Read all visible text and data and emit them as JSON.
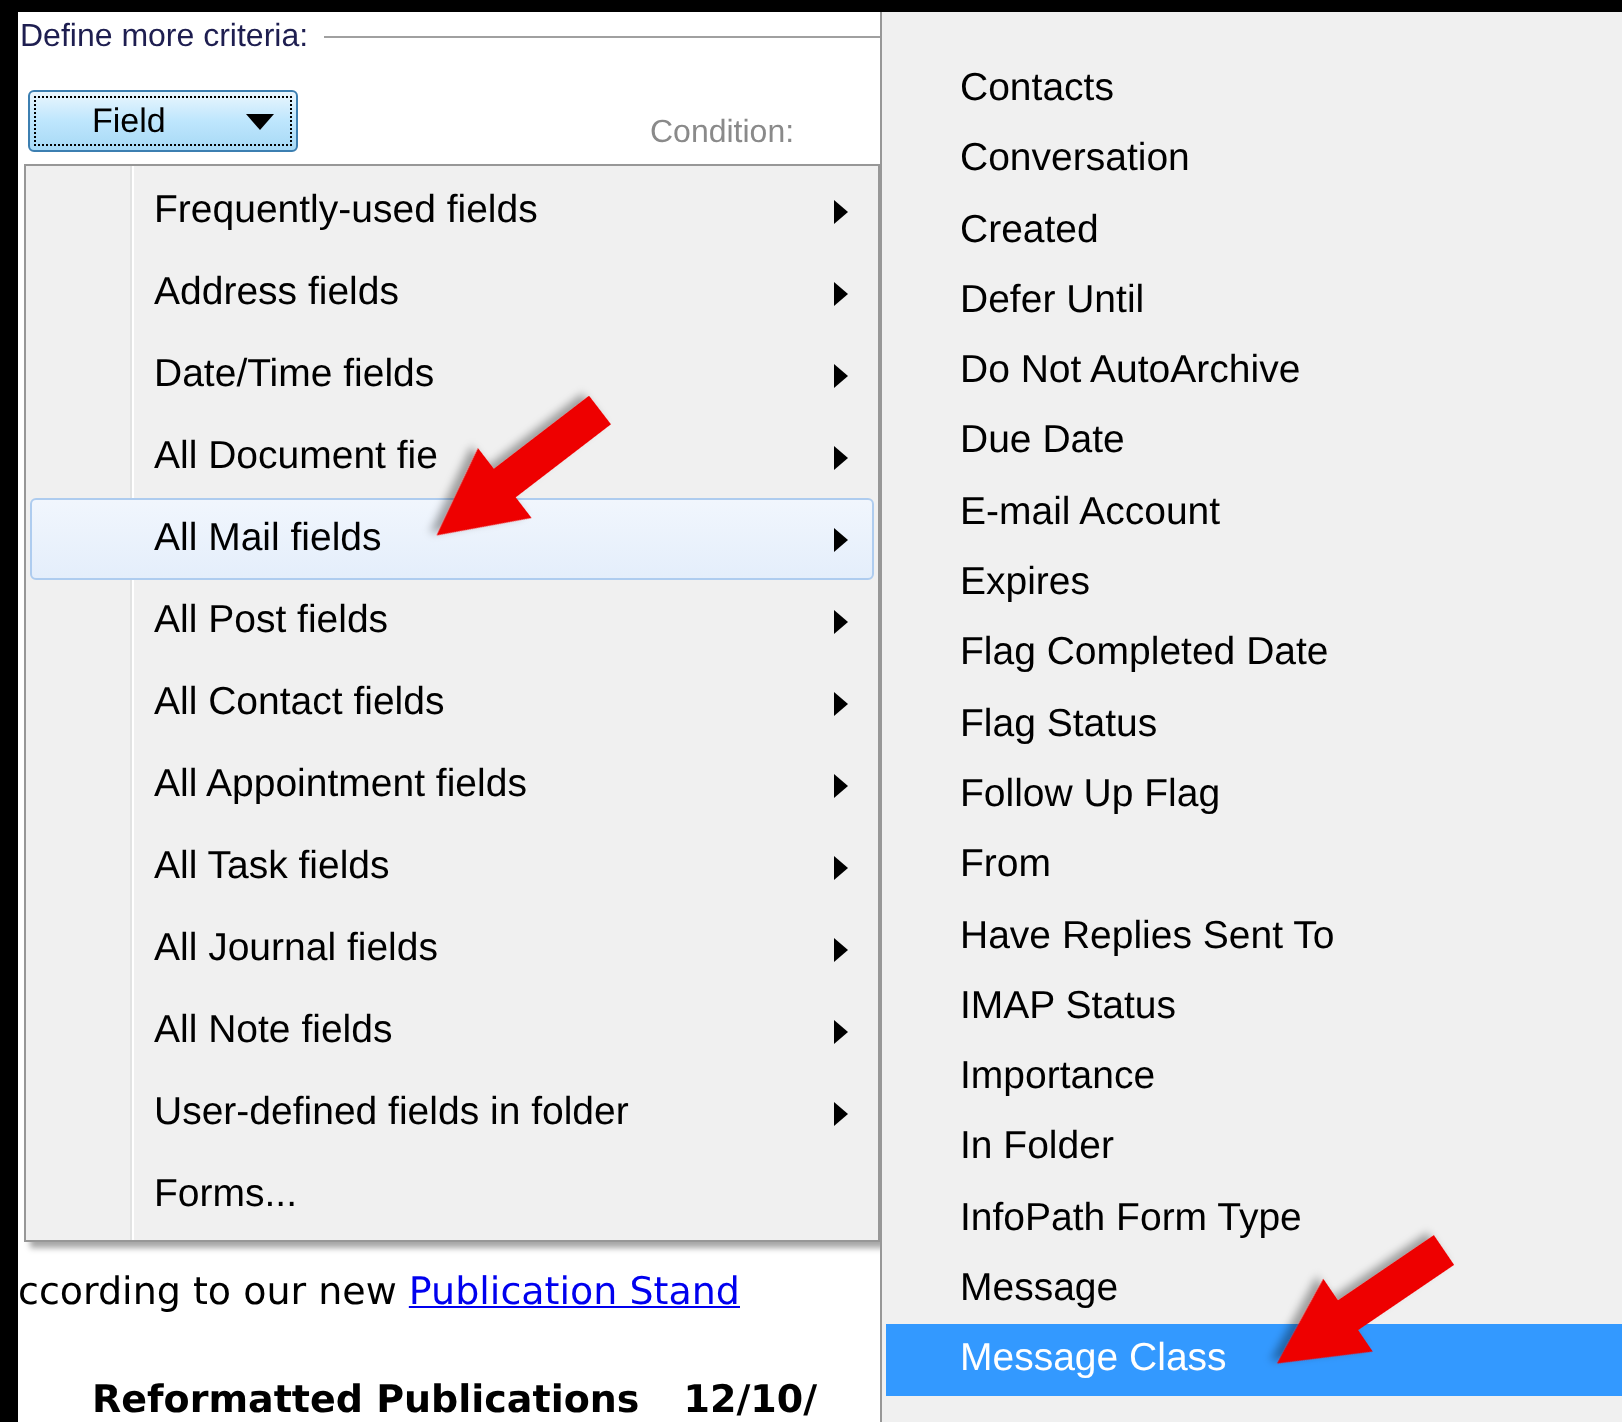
{
  "criteria_label": "Define more criteria:",
  "field_button": {
    "label": "Field"
  },
  "condition_label": "Condition:",
  "field_menu": {
    "items": [
      {
        "label": "Frequently-used fields",
        "submenu": true,
        "selected": false
      },
      {
        "label": "Address fields",
        "submenu": true,
        "selected": false
      },
      {
        "label": "Date/Time fields",
        "submenu": true,
        "selected": false
      },
      {
        "label": "All Document fie",
        "submenu": true,
        "selected": false
      },
      {
        "label": "All Mail fields",
        "submenu": true,
        "selected": true
      },
      {
        "label": "All Post fields",
        "submenu": true,
        "selected": false
      },
      {
        "label": "All Contact fields",
        "submenu": true,
        "selected": false
      },
      {
        "label": "All Appointment fields",
        "submenu": true,
        "selected": false
      },
      {
        "label": "All Task fields",
        "submenu": true,
        "selected": false
      },
      {
        "label": "All Journal fields",
        "submenu": true,
        "selected": false
      },
      {
        "label": "All Note fields",
        "submenu": true,
        "selected": false
      },
      {
        "label": "User-defined fields in folder",
        "submenu": true,
        "selected": false
      },
      {
        "label": "Forms...",
        "submenu": false,
        "selected": false
      }
    ]
  },
  "body_text": {
    "text": "ccording to our new ",
    "link": "Publication Stand"
  },
  "heading": {
    "title": "Reformatted Publications",
    "date": "12/10/"
  },
  "submenu": {
    "items": [
      {
        "label": "Contacts",
        "selected": false
      },
      {
        "label": "Conversation",
        "selected": false
      },
      {
        "label": "Created",
        "selected": false
      },
      {
        "label": "Defer Until",
        "selected": false
      },
      {
        "label": "Do Not AutoArchive",
        "selected": false
      },
      {
        "label": "Due Date",
        "selected": false
      },
      {
        "label": "E-mail Account",
        "selected": false
      },
      {
        "label": "Expires",
        "selected": false
      },
      {
        "label": "Flag Completed Date",
        "selected": false
      },
      {
        "label": "Flag Status",
        "selected": false
      },
      {
        "label": "Follow Up Flag",
        "selected": false
      },
      {
        "label": "From",
        "selected": false
      },
      {
        "label": "Have Replies Sent To",
        "selected": false
      },
      {
        "label": "IMAP Status",
        "selected": false
      },
      {
        "label": "Importance",
        "selected": false
      },
      {
        "label": "In Folder",
        "selected": false
      },
      {
        "label": "InfoPath Form Type",
        "selected": false
      },
      {
        "label": "Message",
        "selected": false
      },
      {
        "label": "Message Class",
        "selected": true
      }
    ]
  }
}
